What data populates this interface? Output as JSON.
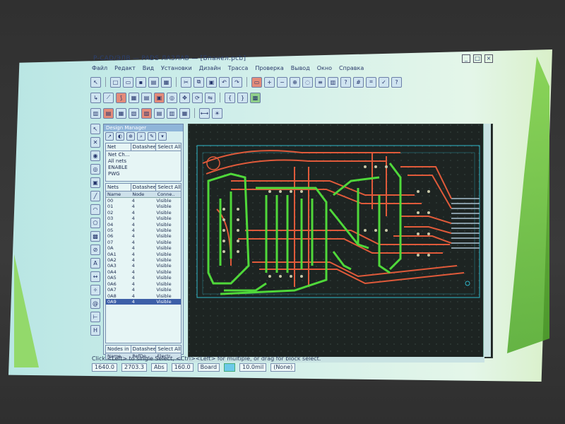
{
  "window": {
    "title": "P-CAD/ЭЛВ — PADS ЛАЗЛАВ — [Бпанел.pcb]",
    "controls": [
      "_",
      "□",
      "×"
    ]
  },
  "menu": [
    "Файл",
    "Редакт",
    "Вид",
    "Установки",
    "Дизайн",
    "Трасса",
    "Проверка",
    "Вывод",
    "Окно",
    "Справка"
  ],
  "design_manager": {
    "title": "Design Manager",
    "nets_panel": {
      "tabs": [
        "Net",
        "Datasheet",
        "Select All"
      ],
      "items": [
        "Net Ch...",
        "All nets",
        "ENABLE",
        "PWG"
      ]
    },
    "nodes_panel": {
      "tabs": [
        "Nets",
        "Datasheet",
        "Select All"
      ],
      "columns": [
        "Name",
        "Node",
        "Conne.."
      ],
      "rows": [
        [
          "00",
          "4",
          "Visible"
        ],
        [
          "01",
          "4",
          "Visible"
        ],
        [
          "02",
          "4",
          "Visible"
        ],
        [
          "03",
          "4",
          "Visible"
        ],
        [
          "04",
          "4",
          "Visible"
        ],
        [
          "05",
          "4",
          "Visible"
        ],
        [
          "06",
          "4",
          "Visible"
        ],
        [
          "07",
          "4",
          "Visible"
        ],
        [
          "0A",
          "4",
          "Visible"
        ],
        [
          "0A1",
          "4",
          "Visible"
        ],
        [
          "0A2",
          "4",
          "Visible"
        ],
        [
          "0A3",
          "4",
          "Visible"
        ],
        [
          "0A4",
          "4",
          "Visible"
        ],
        [
          "0A5",
          "4",
          "Visible"
        ],
        [
          "0A6",
          "4",
          "Visible"
        ],
        [
          "0A7",
          "4",
          "Visible"
        ],
        [
          "0A8",
          "4",
          "Visible"
        ],
        [
          "0A9",
          "4",
          "Visible"
        ]
      ]
    },
    "pins_panel": {
      "tabs": [
        "Nodes in",
        "Datasheet",
        "Select All"
      ],
      "columns": [
        "Name",
        "RefDe..",
        "Electr.."
      ]
    }
  },
  "status": {
    "hint": "Click <Left> to single Select, <Ctrl><Left> for multiple, or drag for block select.",
    "x": "1640.0",
    "y": "2703.3",
    "abs_label": "Abs",
    "grid": "160.0",
    "layer": "Board",
    "width": "10.0mil",
    "none_label": "(None)"
  },
  "colors": {
    "top_trace": "#e05a3a",
    "bottom_trace": "#4fd83a",
    "board_outline": "#2fb7c9",
    "background": "#1d2422"
  }
}
